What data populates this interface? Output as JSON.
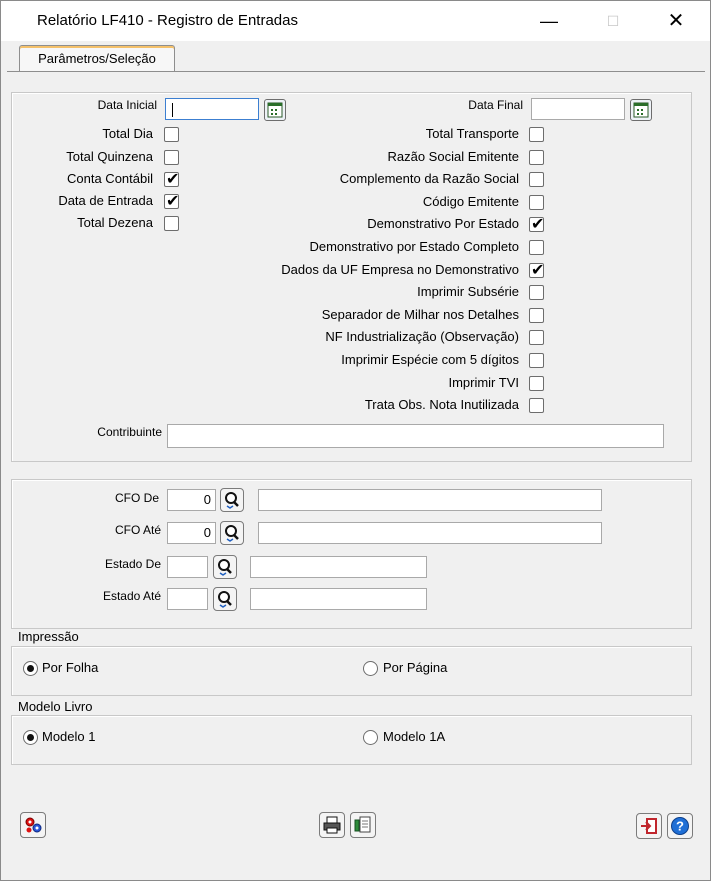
{
  "window": {
    "title": "Relatório LF410 - Registro de Entradas",
    "minimize": "—",
    "maximize": "☐",
    "close": "✕"
  },
  "tab": {
    "label": "Parâmetros/Seleção"
  },
  "dates": {
    "start_label": "Data Inicial",
    "start_value": "",
    "end_label": "Data Final",
    "end_value": ""
  },
  "left_options": [
    {
      "label": "Total Dia",
      "checked": false
    },
    {
      "label": "Total Quinzena",
      "checked": false
    },
    {
      "label": "Conta Contábil",
      "checked": true
    },
    {
      "label": "Data de Entrada",
      "checked": true
    },
    {
      "label": "Total Dezena",
      "checked": false
    }
  ],
  "right_options": [
    {
      "label": "Total Transporte",
      "checked": false
    },
    {
      "label": "Razão Social Emitente",
      "checked": false
    },
    {
      "label": "Complemento da Razão Social",
      "checked": false
    },
    {
      "label": "Código Emitente",
      "checked": false
    },
    {
      "label": "Demonstrativo Por Estado",
      "checked": true
    },
    {
      "label": "Demonstrativo por Estado Completo",
      "checked": false
    },
    {
      "label": "Dados da UF Empresa no Demonstrativo",
      "checked": true
    },
    {
      "label": "Imprimir Subsérie",
      "checked": false
    },
    {
      "label": "Separador de Milhar nos Detalhes",
      "checked": false
    },
    {
      "label": "NF Industrialização (Observação)",
      "checked": false
    },
    {
      "label": "Imprimir Espécie com 5 dígitos",
      "checked": false
    },
    {
      "label": "Imprimir TVI",
      "checked": false
    },
    {
      "label": "Trata Obs. Nota Inutilizada",
      "checked": false
    }
  ],
  "contribuinte": {
    "label": "Contribuinte",
    "value": ""
  },
  "ranges": {
    "cfo_de": {
      "label": "CFO De",
      "value": "0",
      "description": ""
    },
    "cfo_ate": {
      "label": "CFO Até",
      "value": "0",
      "description": ""
    },
    "estado_de": {
      "label": "Estado De",
      "value": "",
      "description": ""
    },
    "estado_ate": {
      "label": "Estado Até",
      "value": "",
      "description": ""
    }
  },
  "impressao": {
    "legend": "Impressão",
    "opt1": "Por Folha",
    "opt2": "Por Página",
    "selected": "Por Folha"
  },
  "modelo": {
    "legend": "Modelo Livro",
    "opt1": "Modelo 1",
    "opt2": "Modelo 1A",
    "selected": "Modelo 1"
  },
  "toolbar_icons": [
    "execute-gears-icon",
    "print-icon",
    "print-settings-icon",
    "exit-icon",
    "help-icon"
  ],
  "colors": {
    "tab_accent": "#f5c16a",
    "help_blue": "#1f6fd6",
    "exit_red": "#c0262d"
  }
}
